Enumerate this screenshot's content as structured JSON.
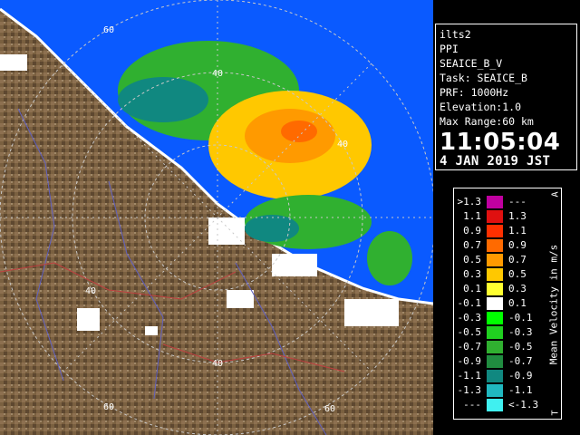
{
  "info_panel": {
    "site": "ilts2",
    "mode": "PPI",
    "product": "SEAICE_B_V",
    "task": "Task: SEAICE_B",
    "prf": "PRF: 1000Hz",
    "elevation": "Elevation:1.0",
    "max_range": "Max Range:60 km",
    "time": "11:05:04",
    "date": "4 JAN 2019 JST"
  },
  "range_labels": {
    "north_60": "60",
    "north_40": "40",
    "east_40": "40",
    "west_40": "40",
    "south_40": "40",
    "south_60": "60",
    "east_60": "60"
  },
  "legend": {
    "title": "Mean Velocity in m/s",
    "corner_top": "A",
    "corner_bottom": "T",
    "rows": [
      {
        "lo": ">1.3",
        "hi": "---",
        "color": "#c000a0"
      },
      {
        "lo": "1.1",
        "hi": "1.3",
        "color": "#e01010"
      },
      {
        "lo": "0.9",
        "hi": "1.1",
        "color": "#ff3000"
      },
      {
        "lo": "0.7",
        "hi": "0.9",
        "color": "#ff6a00"
      },
      {
        "lo": "0.5",
        "hi": "0.7",
        "color": "#ff9a00"
      },
      {
        "lo": "0.3",
        "hi": "0.5",
        "color": "#ffc800"
      },
      {
        "lo": "0.1",
        "hi": "0.3",
        "color": "#ffff30"
      },
      {
        "lo": "-0.1",
        "hi": "0.1",
        "color": "#ffffff"
      },
      {
        "lo": "-0.3",
        "hi": "-0.1",
        "color": "#00ff00"
      },
      {
        "lo": "-0.5",
        "hi": "-0.3",
        "color": "#20d020"
      },
      {
        "lo": "-0.7",
        "hi": "-0.5",
        "color": "#30b030"
      },
      {
        "lo": "-0.9",
        "hi": "-0.7",
        "color": "#208c40"
      },
      {
        "lo": "-1.1",
        "hi": "-0.9",
        "color": "#108880"
      },
      {
        "lo": "-1.3",
        "hi": "-1.1",
        "color": "#20b8c0"
      },
      {
        "lo": "---",
        "hi": "<-1.3",
        "color": "#40f0f0"
      }
    ]
  },
  "colors": {
    "sea": "#0a5aff",
    "land": "#7a6040",
    "range_ring": "#c8c8c8"
  }
}
